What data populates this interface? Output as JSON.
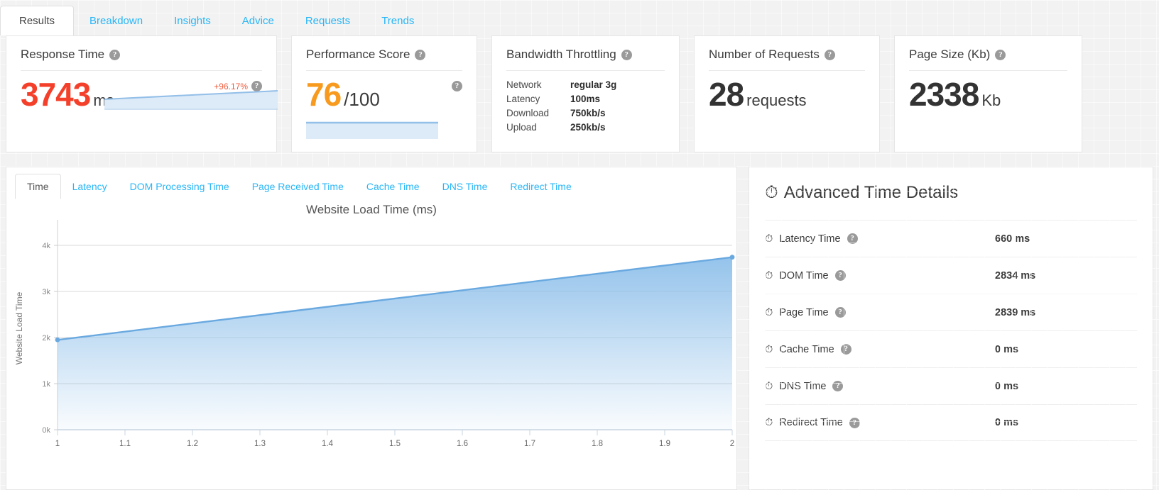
{
  "top_tabs": [
    {
      "label": "Results",
      "active": true
    },
    {
      "label": "Breakdown",
      "active": false
    },
    {
      "label": "Insights",
      "active": false
    },
    {
      "label": "Advice",
      "active": false
    },
    {
      "label": "Requests",
      "active": false
    },
    {
      "label": "Trends",
      "active": false
    }
  ],
  "cards": {
    "response_time": {
      "title": "Response Time",
      "value": "3743",
      "unit": "ms",
      "delta": "+96.17%",
      "color": "#f4402a"
    },
    "performance_score": {
      "title": "Performance Score",
      "value": "76",
      "unit": "/100",
      "color": "#f79a1e"
    },
    "bandwidth": {
      "title": "Bandwidth Throttling",
      "rows": [
        {
          "key": "Network",
          "value": "regular 3g"
        },
        {
          "key": "Latency",
          "value": "100ms"
        },
        {
          "key": "Download",
          "value": "750kb/s"
        },
        {
          "key": "Upload",
          "value": "250kb/s"
        }
      ]
    },
    "requests": {
      "title": "Number of Requests",
      "value": "28",
      "unit": "requests"
    },
    "page_size": {
      "title": "Page Size (Kb)",
      "value": "2338",
      "unit": "Kb"
    }
  },
  "chart_tabs": [
    {
      "label": "Time",
      "active": true
    },
    {
      "label": "Latency",
      "active": false
    },
    {
      "label": "DOM Processing Time",
      "active": false
    },
    {
      "label": "Page Received Time",
      "active": false
    },
    {
      "label": "Cache Time",
      "active": false
    },
    {
      "label": "DNS Time",
      "active": false
    },
    {
      "label": "Redirect Time",
      "active": false
    }
  ],
  "chart_data": {
    "type": "area",
    "title": "Website Load Time (ms)",
    "xlabel": "",
    "ylabel": "Website Load Time",
    "x": [
      1,
      2
    ],
    "values": [
      1950,
      3743
    ],
    "xlim": [
      1,
      2
    ],
    "ylim": [
      0,
      4400
    ],
    "xticks": [
      "1",
      "1.1",
      "1.2",
      "1.3",
      "1.4",
      "1.5",
      "1.6",
      "1.7",
      "1.8",
      "1.9",
      "2"
    ],
    "xtick_values": [
      1,
      1.1,
      1.2,
      1.3,
      1.4,
      1.5,
      1.6,
      1.7,
      1.8,
      1.9,
      2
    ],
    "yticks": [
      "0k",
      "1k",
      "2k",
      "3k",
      "4k"
    ],
    "ytick_values": [
      0,
      1000,
      2000,
      3000,
      4000
    ],
    "grid": true,
    "legend": "none",
    "line_color": "#6aa9e0",
    "fill_color": "#8fc0ea"
  },
  "details": {
    "title": "Advanced Time Details",
    "rows": [
      {
        "label": "Latency Time",
        "value": "660 ms"
      },
      {
        "label": "DOM Time",
        "value": "2834 ms"
      },
      {
        "label": "Page Time",
        "value": "2839 ms"
      },
      {
        "label": "Cache Time",
        "value": "0 ms"
      },
      {
        "label": "DNS Time",
        "value": "0 ms"
      },
      {
        "label": "Redirect Time",
        "value": "0 ms"
      }
    ]
  }
}
